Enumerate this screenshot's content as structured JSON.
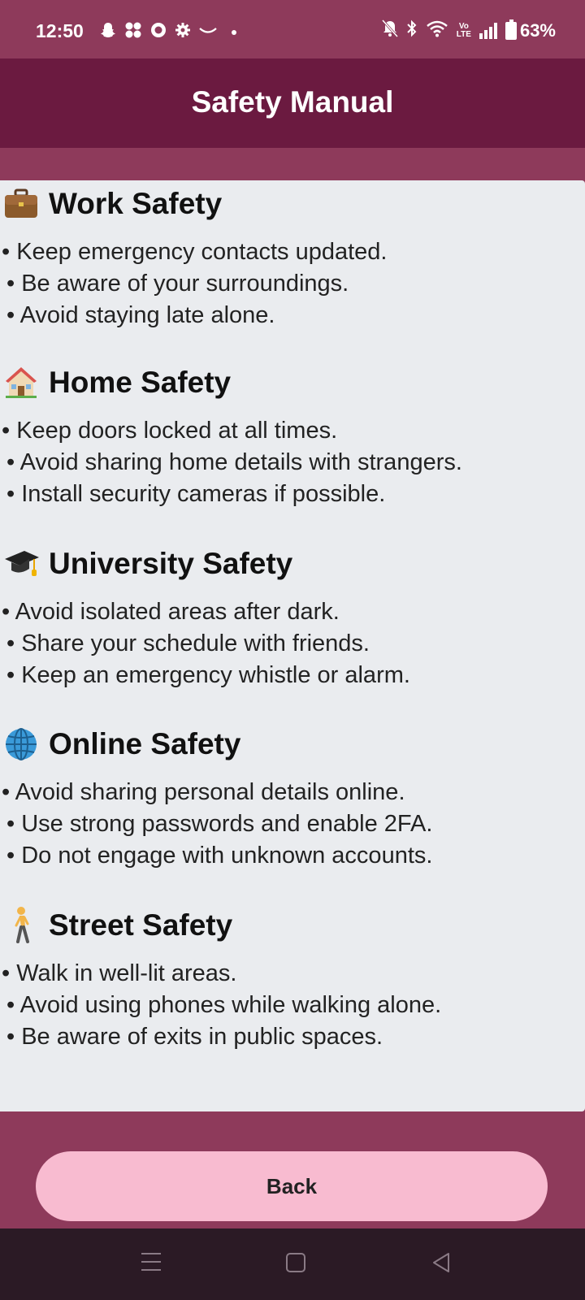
{
  "status_bar": {
    "time": "12:50",
    "battery": "63%",
    "volte_top": "Vo",
    "volte_bottom": "LTE"
  },
  "app_bar": {
    "title": "Safety Manual"
  },
  "sections": [
    {
      "icon": "briefcase-icon",
      "title": "Work Safety",
      "bullets": [
        "• Keep emergency contacts updated.",
        "• Be aware of your surroundings.",
        "• Avoid staying late alone."
      ]
    },
    {
      "icon": "house-icon",
      "title": "Home Safety",
      "bullets": [
        "• Keep doors locked at all times.",
        "• Avoid sharing home details with strangers.",
        "• Install security cameras if possible."
      ]
    },
    {
      "icon": "graduation-cap-icon",
      "title": "University Safety",
      "bullets": [
        "• Avoid isolated areas after dark.",
        "• Share your schedule with friends.",
        "• Keep an emergency whistle or alarm."
      ]
    },
    {
      "icon": "globe-icon",
      "title": "Online Safety",
      "bullets": [
        "• Avoid sharing personal details online.",
        "• Use strong passwords and enable 2FA.",
        "• Do not engage with unknown accounts."
      ]
    },
    {
      "icon": "person-walking-icon",
      "title": "Street Safety",
      "bullets": [
        "• Walk in well-lit areas.",
        "• Avoid using phones while walking alone.",
        "• Be aware of exits in public spaces."
      ]
    }
  ],
  "back_button": {
    "label": "Back"
  },
  "colors": {
    "status_bg": "#8e3a5b",
    "app_bar_bg": "#6b1a40",
    "card_bg": "#eaecef",
    "button_bg": "#f8bbd0",
    "nav_bg": "#2b1a25"
  }
}
